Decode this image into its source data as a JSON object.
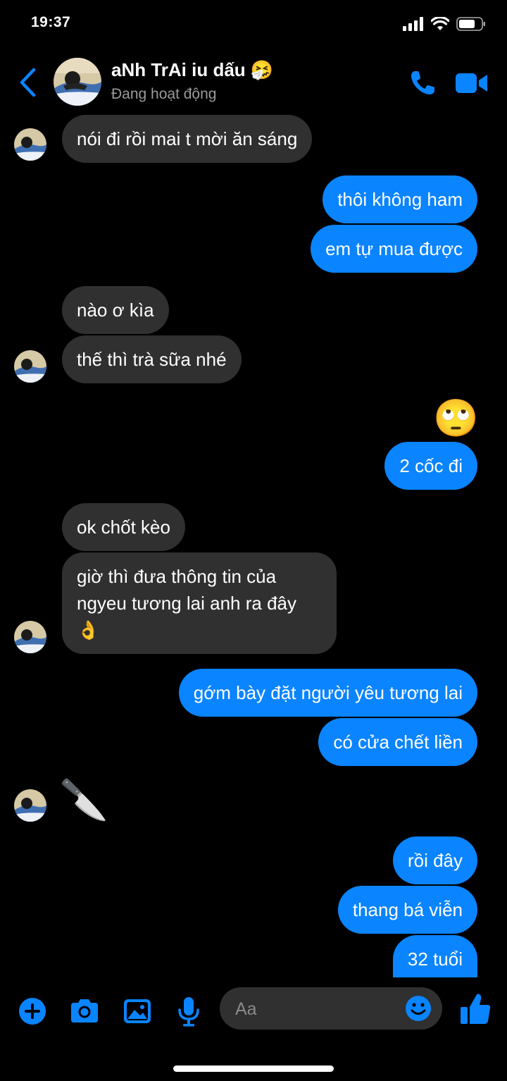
{
  "status_bar": {
    "time": "19:37"
  },
  "header": {
    "contact_name": "aNh TrAi iu dấu 🤧",
    "status": "Đang hoạt động"
  },
  "messages": [
    {
      "side": "in",
      "text": "nói đi rồi mai t mời ăn sáng"
    },
    {
      "side": "out",
      "text": "thôi không ham"
    },
    {
      "side": "out",
      "text": "em tự mua được"
    },
    {
      "side": "in",
      "text": "nào ơ kìa"
    },
    {
      "side": "in",
      "text": "thế thì trà sữa nhé"
    },
    {
      "side": "out",
      "text": "🙄",
      "emoji": true
    },
    {
      "side": "out",
      "text": "2 cốc đi"
    },
    {
      "side": "in",
      "text": "ok chốt kèo"
    },
    {
      "side": "in",
      "text": "giờ thì đưa thông tin của ngyeu tương lai anh ra đây 👌"
    },
    {
      "side": "out",
      "text": "gớm bày đặt người yêu tương lai"
    },
    {
      "side": "out",
      "text": "có cửa chết liền"
    },
    {
      "side": "in",
      "text": "🔪",
      "emoji": true
    },
    {
      "side": "out",
      "text": "rồi đây"
    },
    {
      "side": "out",
      "text": "thang bá viễn"
    },
    {
      "side": "out",
      "text": "32 tuổi"
    }
  ],
  "composer": {
    "placeholder": "Aa"
  },
  "colors": {
    "accent": "#0a84ff",
    "incoming_bubble": "#303030",
    "background": "#000000"
  }
}
